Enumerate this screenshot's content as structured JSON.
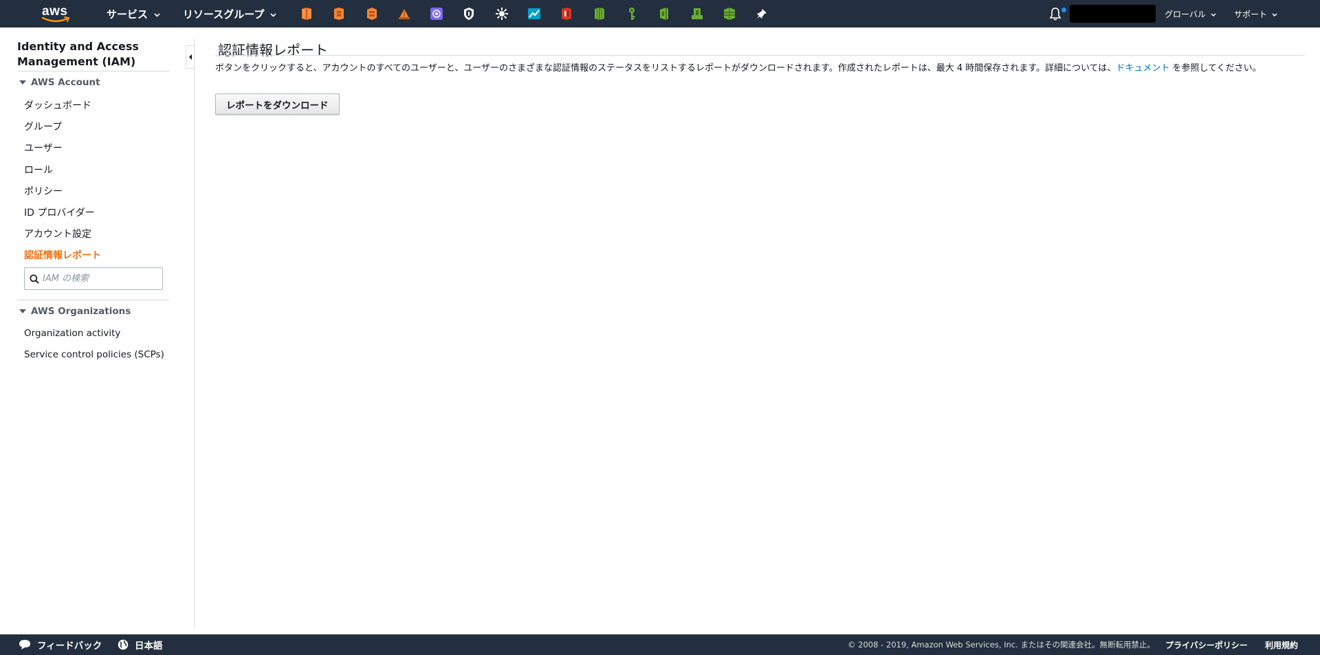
{
  "colors": {
    "nav_bg": "#232f3e",
    "active": "#ec7211",
    "link": "#0073bb",
    "notification_dot": "#1f8ff5"
  },
  "topnav": {
    "logo_text": "aws",
    "services_label": "サービス",
    "resource_groups_label": "リソースグループ",
    "shortcuts": [
      {
        "name": "ec2-icon",
        "color": "#f58536"
      },
      {
        "name": "ecs-icon",
        "color": "#f58536"
      },
      {
        "name": "ec2-container-registry-icon",
        "color": "#f58536"
      },
      {
        "name": "lightsail-icon",
        "color": "#f58536"
      },
      {
        "name": "cognito-icon",
        "color": "#7b68ee"
      },
      {
        "name": "security-shield-icon",
        "color": "#ffffff"
      },
      {
        "name": "settings-sun-icon",
        "color": "#ffffff"
      },
      {
        "name": "quicksight-icon",
        "color": "#00a1c9"
      },
      {
        "name": "iam-red-icon",
        "color": "#dd3522"
      },
      {
        "name": "s3-icon",
        "color": "#6aaf35"
      },
      {
        "name": "key-icon",
        "color": "#6aaf35"
      },
      {
        "name": "service-green-icon",
        "color": "#6aaf35"
      },
      {
        "name": "sns-icon",
        "color": "#6aaf35"
      },
      {
        "name": "elastic-beanstalk-icon",
        "color": "#6aaf35"
      },
      {
        "name": "pin-icon",
        "color": "#ffffff"
      }
    ],
    "region_label": "グローバル",
    "support_label": "サポート"
  },
  "sidebar": {
    "service_title": "Identity and Access Management (IAM)",
    "section1_label": "AWS Account",
    "items": [
      {
        "label": "ダッシュボード"
      },
      {
        "label": "グループ"
      },
      {
        "label": "ユーザー"
      },
      {
        "label": "ロール"
      },
      {
        "label": "ポリシー"
      },
      {
        "label": "ID プロバイダー"
      },
      {
        "label": "アカウント設定"
      },
      {
        "label": "認証情報レポート"
      }
    ],
    "search_placeholder": "IAM の検索",
    "section2_label": "AWS Organizations",
    "org_items": [
      {
        "label": "Organization activity"
      },
      {
        "label": "Service control policies (SCPs)"
      }
    ]
  },
  "main": {
    "title": "認証情報レポート",
    "description_before": "ボタンをクリックすると、アカウントのすべてのユーザーと、ユーザーのさまざまな認証情報のステータスをリストするレポートがダウンロードされます。作成されたレポートは、最大 4 時間保存されます。詳細については、",
    "description_link": "ドキュメント",
    "description_after": " を参照してください。",
    "download_button": "レポートをダウンロード"
  },
  "footer": {
    "feedback_label": "フィードバック",
    "language_label": "日本語",
    "copyright": "© 2008 - 2019, Amazon Web Services, Inc. またはその関連会社。無断転用禁止。",
    "privacy_label": "プライバシーポリシー",
    "terms_label": "利用規約"
  }
}
